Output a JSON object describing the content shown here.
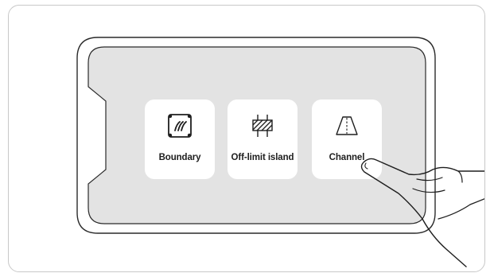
{
  "options": [
    {
      "label": "Boundary",
      "icon": "boundary-icon"
    },
    {
      "label": "Off-limit island",
      "icon": "off-limit-island-icon"
    },
    {
      "label": "Channel",
      "icon": "channel-icon"
    }
  ],
  "colors": {
    "screen_background": "#e3e3e3",
    "button_background": "#ffffff",
    "outline": "#2a2a2a",
    "frame_border": "#c8c8c8"
  },
  "pointer": "tap-hand-icon"
}
